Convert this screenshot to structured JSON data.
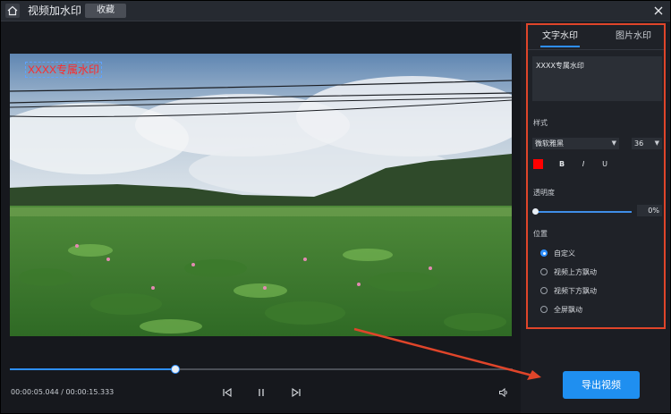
{
  "window": {
    "title": "视频加水印",
    "favorite_label": "收藏"
  },
  "preview": {
    "watermark_text": "XXXX专属水印",
    "watermark_color": "#ff2a2a",
    "playback_progress": 0.33
  },
  "timeline": {
    "current_time": "00:00:05.044",
    "separator": "/",
    "total_time": "00:00:15.333",
    "time_display": "00:00:05.044 / 00:00:15.333"
  },
  "panel": {
    "tabs": [
      {
        "label": "文字水印",
        "active": true
      },
      {
        "label": "图片水印",
        "active": false
      }
    ],
    "text_value": "XXXX专属水印",
    "style_label": "样式",
    "font_family": "微软雅黑",
    "font_size": "36",
    "text_color": "#ff0000",
    "format_buttons": [
      "B",
      "I",
      "U"
    ],
    "opacity_label": "透明度",
    "opacity_value": "0%",
    "position_label": "位置",
    "position_options": [
      {
        "label": "自定义",
        "checked": true
      },
      {
        "label": "视频上方飘动",
        "checked": false
      },
      {
        "label": "视频下方飘动",
        "checked": false
      },
      {
        "label": "全屏飘动",
        "checked": false
      }
    ]
  },
  "export_label": "导出视频",
  "colors": {
    "accent": "#2e8fff",
    "highlight_border": "#e0452a",
    "export_button": "#1f8ff0"
  }
}
